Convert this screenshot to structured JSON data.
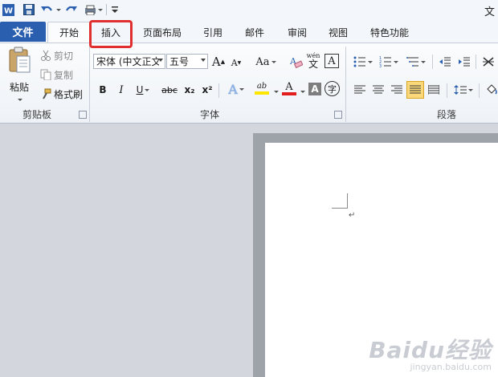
{
  "quick_access": {
    "app_icon": "word-icon",
    "save_icon": "save-icon",
    "undo_icon": "undo-icon",
    "redo_icon": "redo-icon",
    "customize_icon": "customize-icon",
    "title_fragment": "文"
  },
  "tabs": [
    {
      "label": "文件",
      "active": false
    },
    {
      "label": "开始",
      "active": true
    },
    {
      "label": "插入",
      "active": false,
      "highlighted": true
    },
    {
      "label": "页面布局",
      "active": false
    },
    {
      "label": "引用",
      "active": false
    },
    {
      "label": "邮件",
      "active": false
    },
    {
      "label": "审阅",
      "active": false
    },
    {
      "label": "视图",
      "active": false
    },
    {
      "label": "特色功能",
      "active": false
    }
  ],
  "clipboard": {
    "group_label": "剪贴板",
    "paste_label": "粘贴",
    "cut_label": "剪切",
    "copy_label": "复制",
    "format_painter_label": "格式刷"
  },
  "font": {
    "group_label": "字体",
    "font_name": "宋体 (中文正文",
    "font_size": "五号",
    "grow_label": "A",
    "shrink_label": "A",
    "change_case_label": "Aa",
    "clear_format_label": "A",
    "phonetic_label": "wén",
    "phonetic_char": "文",
    "border_label": "A",
    "bold": "B",
    "italic": "I",
    "underline": "U",
    "strike": "abc",
    "subscript": "x₂",
    "superscript": "x²",
    "text_effect": "A",
    "highlight": "ab",
    "font_color": "A",
    "shading": "A",
    "enclose": "字"
  },
  "paragraph": {
    "group_label": "段落"
  },
  "colors": {
    "accent_file_tab": "#2a5fb0",
    "highlight_box": "#e02f2f",
    "font_color_bar": "#e11d1d",
    "highlight_bar": "#ffe600"
  },
  "watermark": {
    "main": "Baidu经验",
    "sub": "jingyan.baidu.com"
  }
}
